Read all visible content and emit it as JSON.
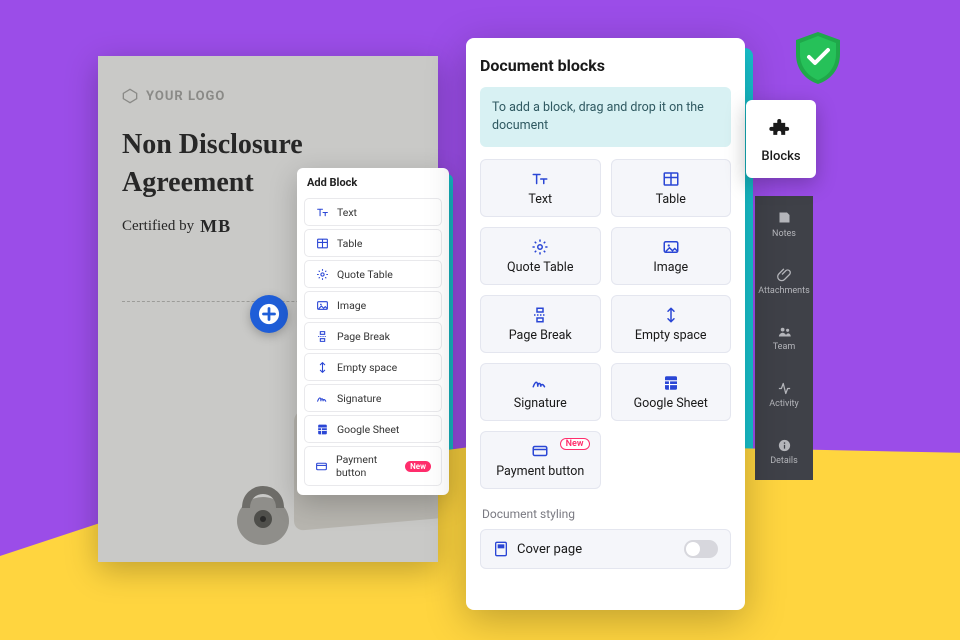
{
  "document": {
    "logo_text": "YOUR LOGO",
    "title": "Non Disclosure Agreement",
    "certified_by_label": "Certified by",
    "certifier": "MB"
  },
  "popover": {
    "title": "Add Block",
    "items": [
      {
        "label": "Text",
        "icon": "text-size-icon"
      },
      {
        "label": "Table",
        "icon": "table-icon"
      },
      {
        "label": "Quote Table",
        "icon": "gear-icon"
      },
      {
        "label": "Image",
        "icon": "image-icon"
      },
      {
        "label": "Page Break",
        "icon": "page-break-icon"
      },
      {
        "label": "Empty space",
        "icon": "vertical-arrows-icon"
      },
      {
        "label": "Signature",
        "icon": "signature-icon"
      },
      {
        "label": "Google Sheet",
        "icon": "spreadsheet-icon"
      },
      {
        "label": "Payment button",
        "icon": "card-icon",
        "badge": "New"
      }
    ]
  },
  "panel": {
    "title": "Document blocks",
    "hint": "To add a block, drag and drop it on the document",
    "cards": [
      {
        "label": "Text",
        "icon": "text-size-icon"
      },
      {
        "label": "Table",
        "icon": "table-icon"
      },
      {
        "label": "Quote Table",
        "icon": "gear-icon"
      },
      {
        "label": "Image",
        "icon": "image-icon"
      },
      {
        "label": "Page Break",
        "icon": "page-break-icon"
      },
      {
        "label": "Empty space",
        "icon": "vertical-arrows-icon"
      },
      {
        "label": "Signature",
        "icon": "signature-icon"
      },
      {
        "label": "Google Sheet",
        "icon": "spreadsheet-icon"
      },
      {
        "label": "Payment button",
        "icon": "card-icon",
        "badge": "New"
      }
    ],
    "styling_label": "Document styling",
    "cover_page_label": "Cover page"
  },
  "sidebar": {
    "items": [
      {
        "label": "Notes",
        "icon": "notes-icon"
      },
      {
        "label": "Attachments",
        "icon": "paperclip-icon"
      },
      {
        "label": "Team",
        "icon": "team-icon"
      },
      {
        "label": "Activity",
        "icon": "activity-icon"
      },
      {
        "label": "Details",
        "icon": "info-icon"
      }
    ]
  },
  "blocks_chip": {
    "label": "Blocks"
  }
}
